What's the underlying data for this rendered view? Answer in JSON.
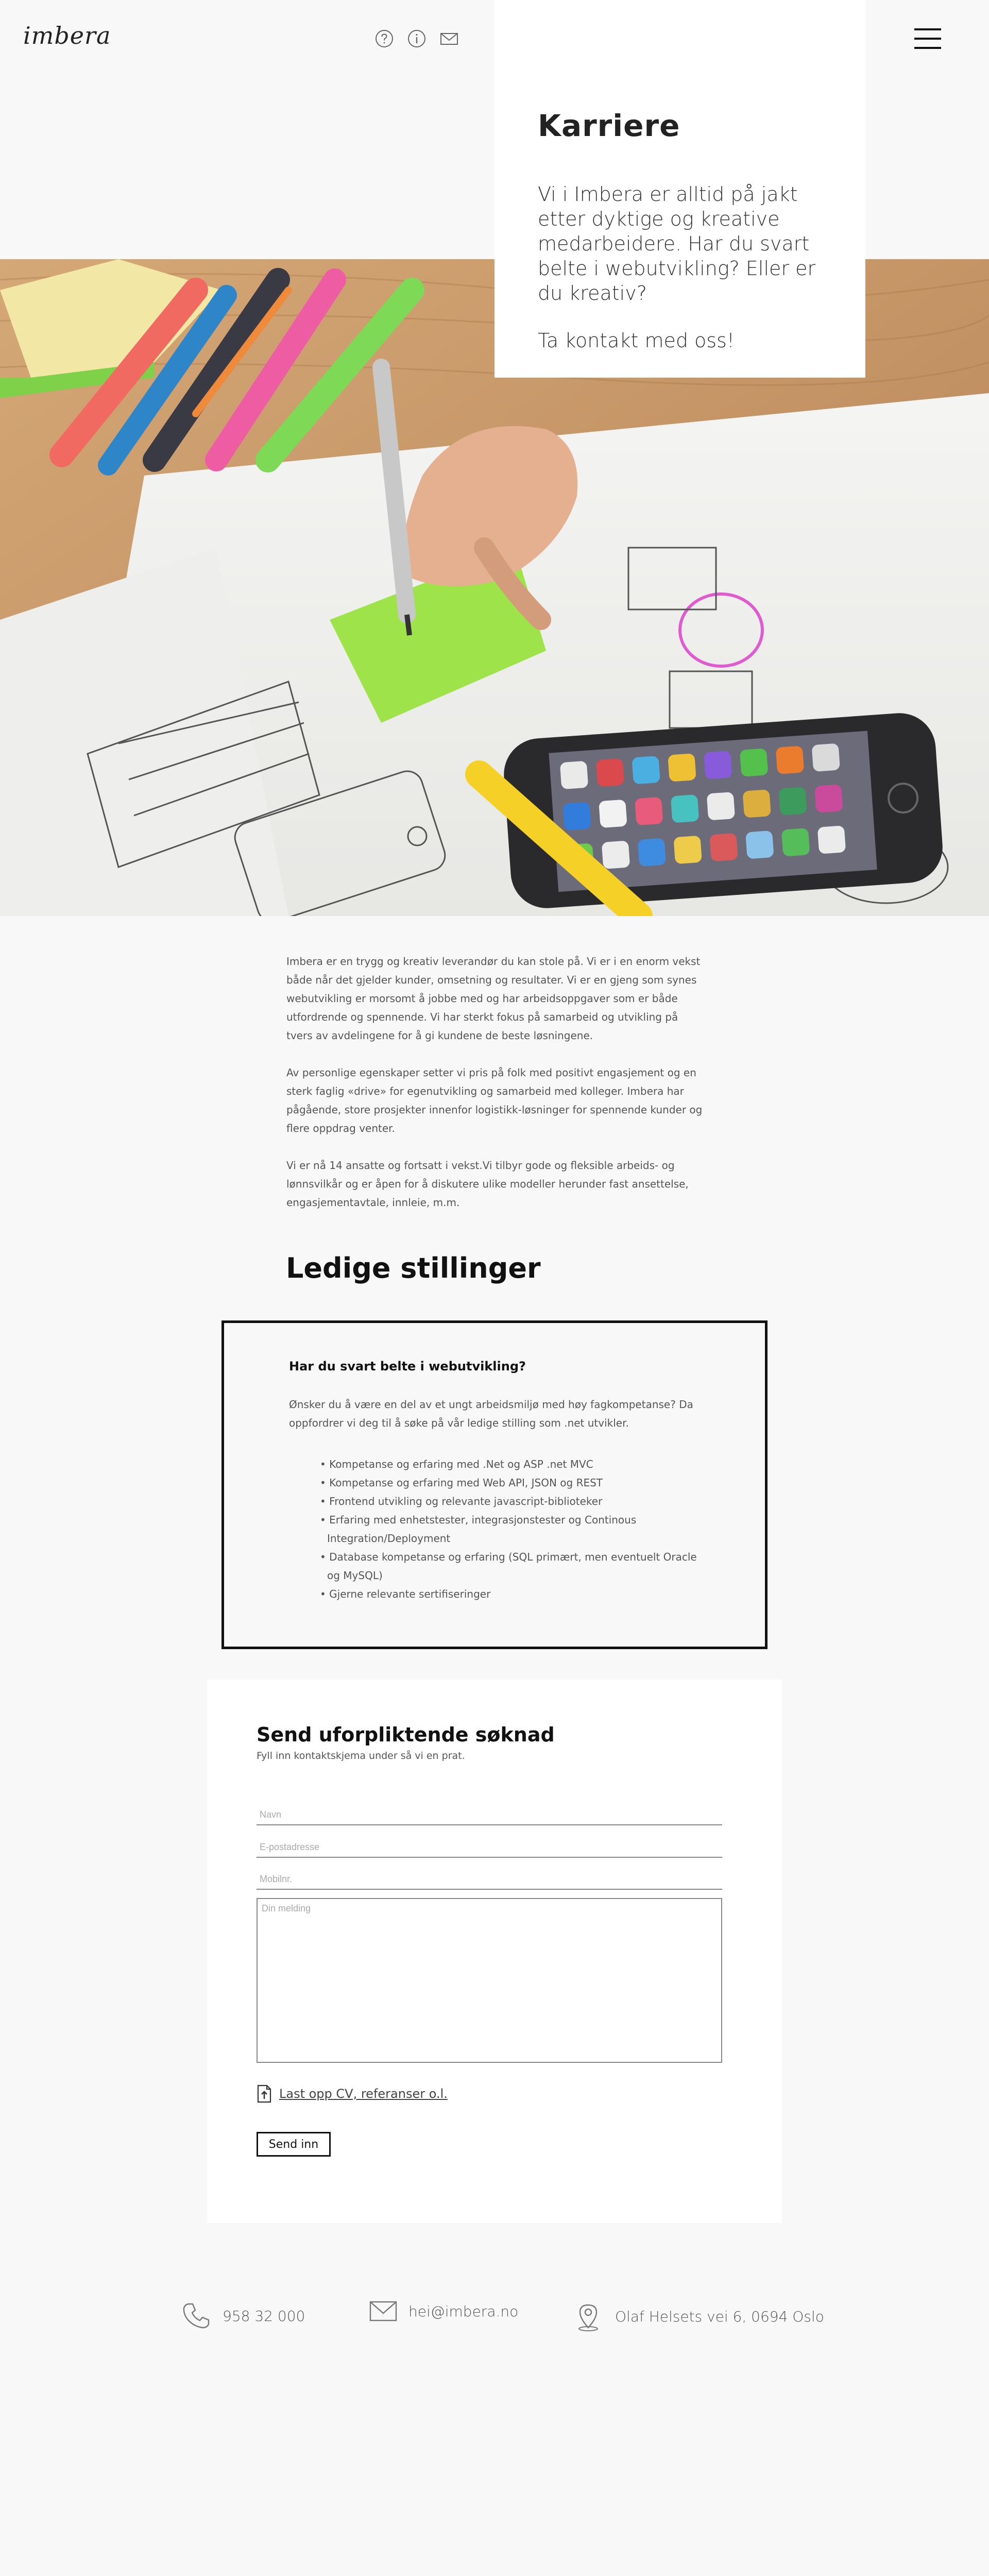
{
  "header": {
    "logo": "imbera",
    "icons": [
      "help-icon",
      "info-icon",
      "mail-icon",
      "menu-icon"
    ]
  },
  "career": {
    "title": "Karriere",
    "text": "Vi i Imbera er alltid på jakt etter dyktige og kreative medarbeidere. Har du svart belte i webutvikling? Eller er du kreativ?",
    "contact": "Ta kontakt med oss!"
  },
  "intro": {
    "p1": "Imbera er en trygg og kreativ leverandør du kan stole på. Vi er i en enorm vekst både når det gjelder kunder, omsetning og resultater. Vi er en gjeng som synes webutvikling er morsomt å jobbe med og har arbeidsoppgaver som er både utfordrende og spennende. Vi har sterkt fokus på samarbeid og utvikling på tvers av avdelingene for å gi kundene de beste løsningene.",
    "p2": "Av personlige egenskaper setter vi pris på folk med positivt engasjement og en sterk faglig «drive» for egenutvikling og samarbeid med kolleger. Imbera har pågående, store prosjekter innenfor logistikk-løsninger for spennende kunder og flere oppdrag venter.",
    "p3": "Vi er nå 14 ansatte og fortsatt i vekst.Vi tilbyr gode og fleksible arbeids- og lønnsvilkår og er åpen for å diskutere ulike modeller herunder fast ansettelse, engasjementavtale, innleie, m.m."
  },
  "positions": {
    "title": "Ledige stillinger",
    "job": {
      "title": "Har du svart belte i webutvikling?",
      "description": "Ønsker du å være en del av et ungt arbeidsmiljø med høy fagkompetanse? Da oppfordrer vi deg til å søke på vår ledige stilling som .net utvikler.",
      "requirements": [
        "• Kompetanse og erfaring med .Net og ASP .net MVC",
        "• Kompetanse og erfaring med Web API, JSON og REST",
        "• Frontend utvikling og relevante javascript-biblioteker",
        "• Erfaring med enhetstester, integrasjonstester og Continous Integration/Deployment",
        "• Database kompetanse og erfaring (SQL primært, men eventuelt Oracle og MySQL)",
        "• Gjerne relevante sertifiseringer"
      ]
    }
  },
  "form": {
    "title": "Send uforpliktende søknad",
    "subtitle": "Fyll inn kontaktskjema under så vi en prat.",
    "name_placeholder": "Navn",
    "email_placeholder": "E-postadresse",
    "mobile_placeholder": "Mobilnr.",
    "message_placeholder": "Din melding",
    "upload_label": "Last opp CV, referanser o.l.",
    "submit_label": "Send inn"
  },
  "footer": {
    "phone": "958 32 000",
    "email": "hei@imbera.no",
    "address": "Olaf Helsets vei 6, 0694 Oslo"
  }
}
